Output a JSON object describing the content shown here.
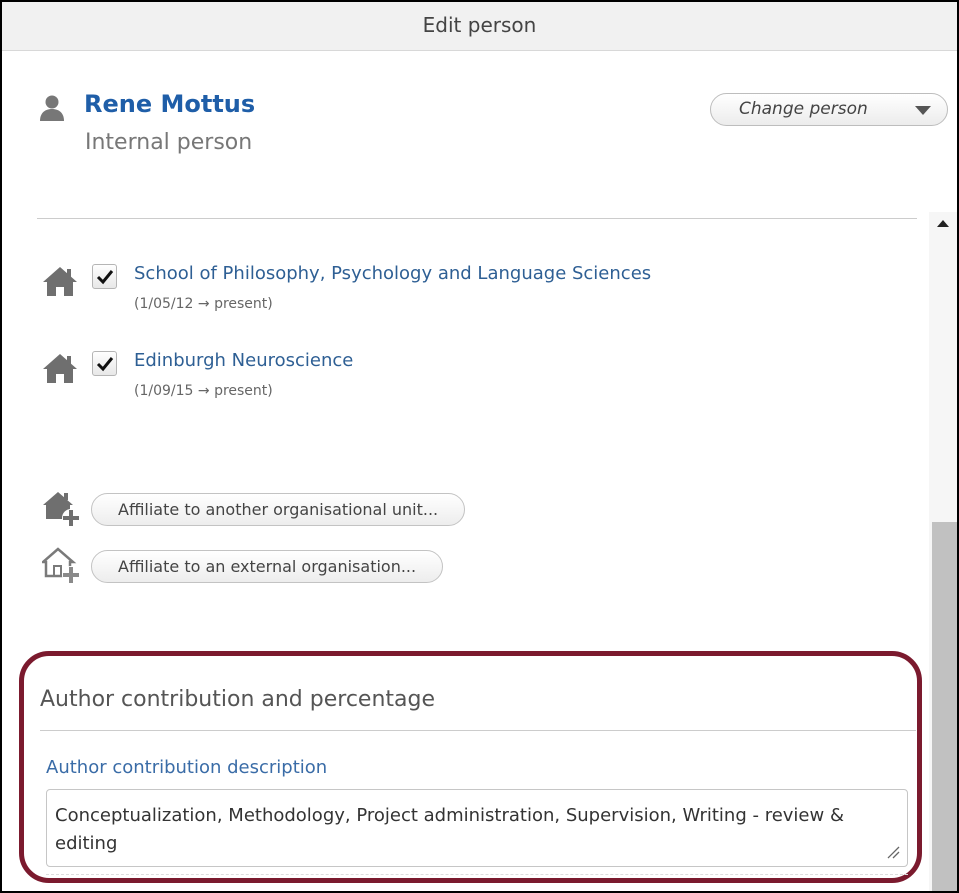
{
  "dialog": {
    "title": "Edit person"
  },
  "person": {
    "name": "Rene Mottus",
    "type": "Internal person",
    "change_label": "Change person"
  },
  "affiliations": [
    {
      "name": "School of Philosophy, Psychology and Language Sciences",
      "dates": "(1/05/12 → present)",
      "checked": true
    },
    {
      "name": "Edinburgh Neuroscience",
      "dates": "(1/09/15 → present)",
      "checked": true
    }
  ],
  "actions": {
    "affiliate_internal": "Affiliate to another organisational unit...",
    "affiliate_external": "Affiliate to an external organisation..."
  },
  "contribution": {
    "section_title": "Author contribution and percentage",
    "field_label": "Author contribution description",
    "value": "Conceptualization, Methodology, Project administration, Supervision, Writing - review & editing"
  },
  "colors": {
    "link_blue": "#1f5ea8",
    "highlight_border": "#7b1a2e"
  },
  "icons": [
    "person-icon",
    "house-icon",
    "checkmark-icon",
    "add-house-icon",
    "add-external-house-icon",
    "caret-down-icon",
    "scroll-up-icon",
    "resize-grip-icon"
  ]
}
